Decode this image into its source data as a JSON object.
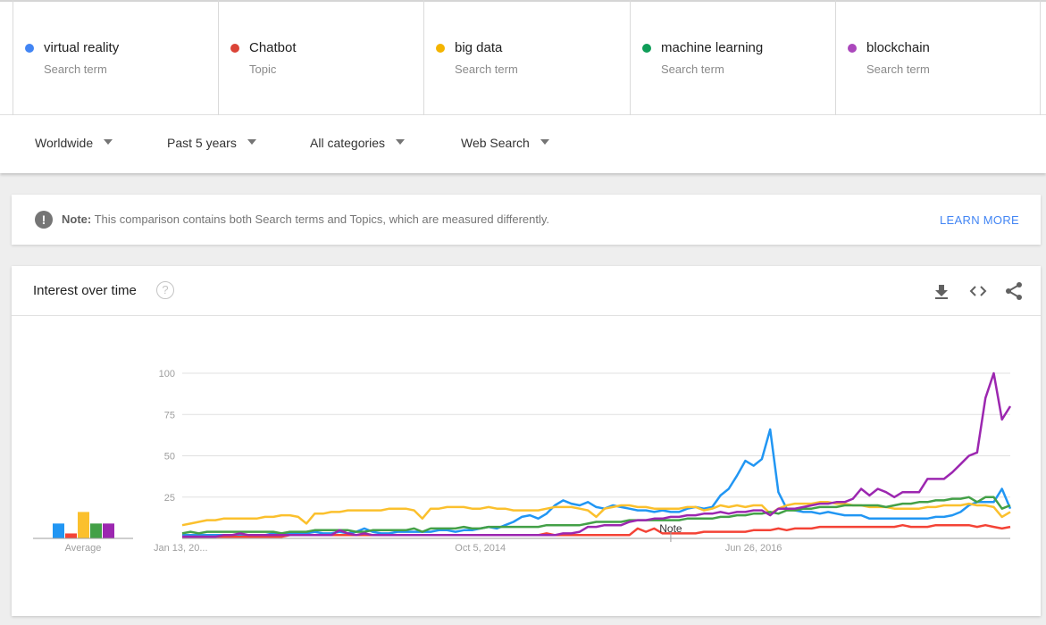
{
  "terms": [
    {
      "name": "virtual reality",
      "kind": "Search term",
      "color": "#4285f4"
    },
    {
      "name": "Chatbot",
      "kind": "Topic",
      "color": "#db4437"
    },
    {
      "name": "big data",
      "kind": "Search term",
      "color": "#f4b400"
    },
    {
      "name": "machine learning",
      "kind": "Search term",
      "color": "#0f9d58"
    },
    {
      "name": "blockchain",
      "kind": "Search term",
      "color": "#ab47bc"
    }
  ],
  "filters": {
    "region": "Worldwide",
    "time": "Past 5 years",
    "category": "All categories",
    "search_type": "Web Search"
  },
  "note": {
    "label": "Note:",
    "text": "This comparison contains both Search terms and Topics, which are measured differently.",
    "link": "LEARN MORE"
  },
  "panel": {
    "title": "Interest over time",
    "help_glyph": "?"
  },
  "chart_data": {
    "type": "line",
    "title": "Interest over time",
    "xlabel": "",
    "ylabel": "",
    "ylim": [
      0,
      100
    ],
    "yticks": [
      25,
      50,
      75,
      100
    ],
    "grid": true,
    "x_tick_labels": [
      "Jan 13, 20...",
      "Oct 5, 2014",
      "Jun 26, 2016"
    ],
    "x_tick_positions": [
      0.0,
      0.36,
      0.69
    ],
    "annotation": {
      "label": "Note",
      "position": 0.59
    },
    "legend": "top",
    "average_label": "Average",
    "series": [
      {
        "name": "virtual reality",
        "color": "#2196f3",
        "average": 9,
        "values": [
          2,
          2,
          2,
          2,
          2,
          2,
          2,
          2,
          2,
          2,
          2,
          3,
          3,
          3,
          3,
          3,
          4,
          3,
          3,
          4,
          3,
          4,
          6,
          4,
          3,
          3,
          4,
          4,
          4,
          4,
          4,
          5,
          5,
          4,
          5,
          5,
          6,
          7,
          6,
          8,
          10,
          13,
          14,
          12,
          15,
          20,
          23,
          21,
          20,
          22,
          19,
          18,
          20,
          19,
          18,
          17,
          17,
          16,
          17,
          16,
          16,
          18,
          19,
          18,
          19,
          26,
          30,
          38,
          47,
          44,
          48,
          66,
          28,
          18,
          17,
          16,
          16,
          15,
          16,
          15,
          14,
          14,
          14,
          12,
          12,
          12,
          12,
          12,
          12,
          12,
          12,
          13,
          13,
          14,
          16,
          20,
          22,
          22,
          22,
          30,
          18
        ]
      },
      {
        "name": "Chatbot",
        "color": "#f44336",
        "average": 3,
        "values": [
          1,
          1,
          1,
          1,
          1,
          1,
          1,
          1,
          1,
          1,
          1,
          1,
          1,
          2,
          2,
          2,
          2,
          2,
          2,
          2,
          2,
          2,
          2,
          2,
          2,
          2,
          2,
          2,
          2,
          2,
          2,
          2,
          2,
          2,
          2,
          2,
          2,
          2,
          2,
          2,
          2,
          2,
          2,
          2,
          3,
          2,
          2,
          2,
          2,
          2,
          2,
          2,
          2,
          2,
          2,
          6,
          4,
          6,
          3,
          3,
          3,
          3,
          3,
          4,
          4,
          4,
          4,
          4,
          4,
          5,
          5,
          5,
          6,
          5,
          6,
          6,
          6,
          7,
          7,
          7,
          7,
          7,
          7,
          7,
          7,
          7,
          7,
          8,
          7,
          7,
          7,
          8,
          8,
          8,
          8,
          8,
          7,
          8,
          7,
          6,
          7
        ]
      },
      {
        "name": "big data",
        "color": "#fbc02d",
        "average": 16,
        "values": [
          8,
          9,
          10,
          11,
          11,
          12,
          12,
          12,
          12,
          12,
          13,
          13,
          14,
          14,
          13,
          9,
          15,
          15,
          16,
          16,
          17,
          17,
          17,
          17,
          17,
          18,
          18,
          18,
          17,
          12,
          18,
          18,
          19,
          19,
          19,
          18,
          18,
          19,
          18,
          18,
          17,
          17,
          17,
          17,
          18,
          19,
          19,
          19,
          18,
          17,
          13,
          18,
          19,
          20,
          20,
          19,
          19,
          18,
          18,
          18,
          18,
          19,
          19,
          17,
          18,
          20,
          19,
          20,
          19,
          20,
          20,
          15,
          18,
          20,
          21,
          21,
          21,
          22,
          22,
          21,
          21,
          20,
          20,
          19,
          19,
          19,
          18,
          18,
          18,
          18,
          19,
          19,
          20,
          20,
          20,
          21,
          20,
          20,
          19,
          13,
          16
        ]
      },
      {
        "name": "machine learning",
        "color": "#43a047",
        "average": 9,
        "values": [
          3,
          4,
          3,
          4,
          4,
          4,
          4,
          4,
          4,
          4,
          4,
          4,
          3,
          4,
          4,
          4,
          5,
          5,
          5,
          5,
          5,
          4,
          4,
          5,
          5,
          5,
          5,
          5,
          6,
          4,
          6,
          6,
          6,
          6,
          7,
          6,
          6,
          7,
          7,
          7,
          7,
          7,
          7,
          7,
          8,
          8,
          8,
          8,
          8,
          9,
          10,
          10,
          10,
          10,
          11,
          11,
          11,
          11,
          11,
          11,
          11,
          12,
          12,
          12,
          12,
          13,
          13,
          14,
          14,
          15,
          15,
          16,
          15,
          17,
          17,
          18,
          18,
          19,
          19,
          19,
          20,
          20,
          20,
          20,
          20,
          19,
          20,
          21,
          21,
          22,
          22,
          23,
          23,
          24,
          24,
          25,
          22,
          25,
          25,
          18,
          20
        ]
      },
      {
        "name": "blockchain",
        "color": "#9c27b0",
        "average": 9,
        "values": [
          1,
          1,
          1,
          1,
          1,
          2,
          2,
          3,
          2,
          2,
          2,
          2,
          2,
          2,
          2,
          2,
          2,
          2,
          2,
          5,
          3,
          2,
          3,
          2,
          2,
          2,
          2,
          2,
          2,
          2,
          2,
          2,
          2,
          2,
          2,
          2,
          2,
          2,
          2,
          2,
          2,
          2,
          2,
          2,
          2,
          2,
          3,
          3,
          4,
          7,
          7,
          8,
          8,
          8,
          10,
          11,
          11,
          12,
          12,
          13,
          13,
          14,
          14,
          15,
          15,
          16,
          15,
          16,
          16,
          17,
          17,
          14,
          18,
          18,
          18,
          19,
          20,
          21,
          21,
          22,
          22,
          24,
          30,
          26,
          30,
          28,
          25,
          28,
          28,
          28,
          36,
          36,
          36,
          40,
          45,
          50,
          52,
          85,
          100,
          72,
          80
        ]
      }
    ]
  }
}
